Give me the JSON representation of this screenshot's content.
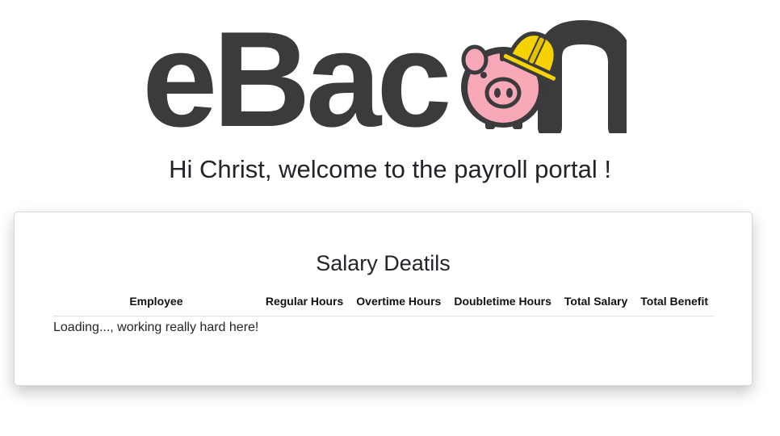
{
  "brand": {
    "logo_text": "eBacon",
    "colors": {
      "text": "#3b3b3d",
      "pig": "#f9a8b8",
      "helmet": "#f5d200"
    }
  },
  "welcome": {
    "message": "Hi Christ, welcome to the payroll portal !"
  },
  "salary_card": {
    "title": "Salary Deatils",
    "columns": [
      "Employee",
      "Regular Hours",
      "Overtime Hours",
      "Doubletime Hours",
      "Total Salary",
      "Total Benefit"
    ],
    "loading_text": "Loading..., working really hard here!"
  }
}
